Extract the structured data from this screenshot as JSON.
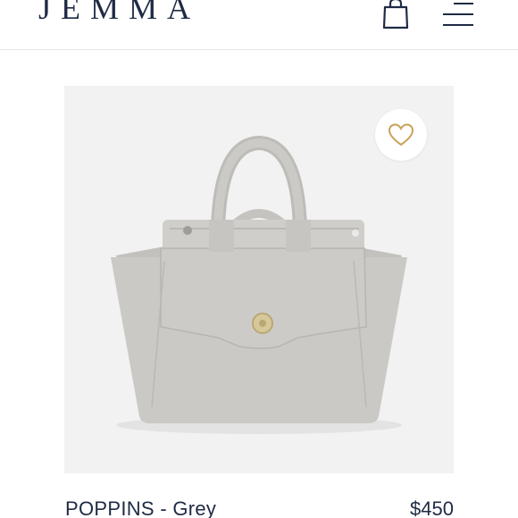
{
  "header": {
    "brand": "JEMMA",
    "cart_icon": "shopping-bag-icon",
    "menu_icon": "menu-icon"
  },
  "product": {
    "name": "POPPINS - Grey",
    "price": "$450",
    "image_icon": "handbag-image",
    "wishlist_icon": "heart-icon",
    "colors": {
      "image_bg": "#f1f2f1",
      "bag": "#c9c8c4",
      "wishlist_heart": "#c9a25a",
      "text": "#1f2a44"
    }
  }
}
